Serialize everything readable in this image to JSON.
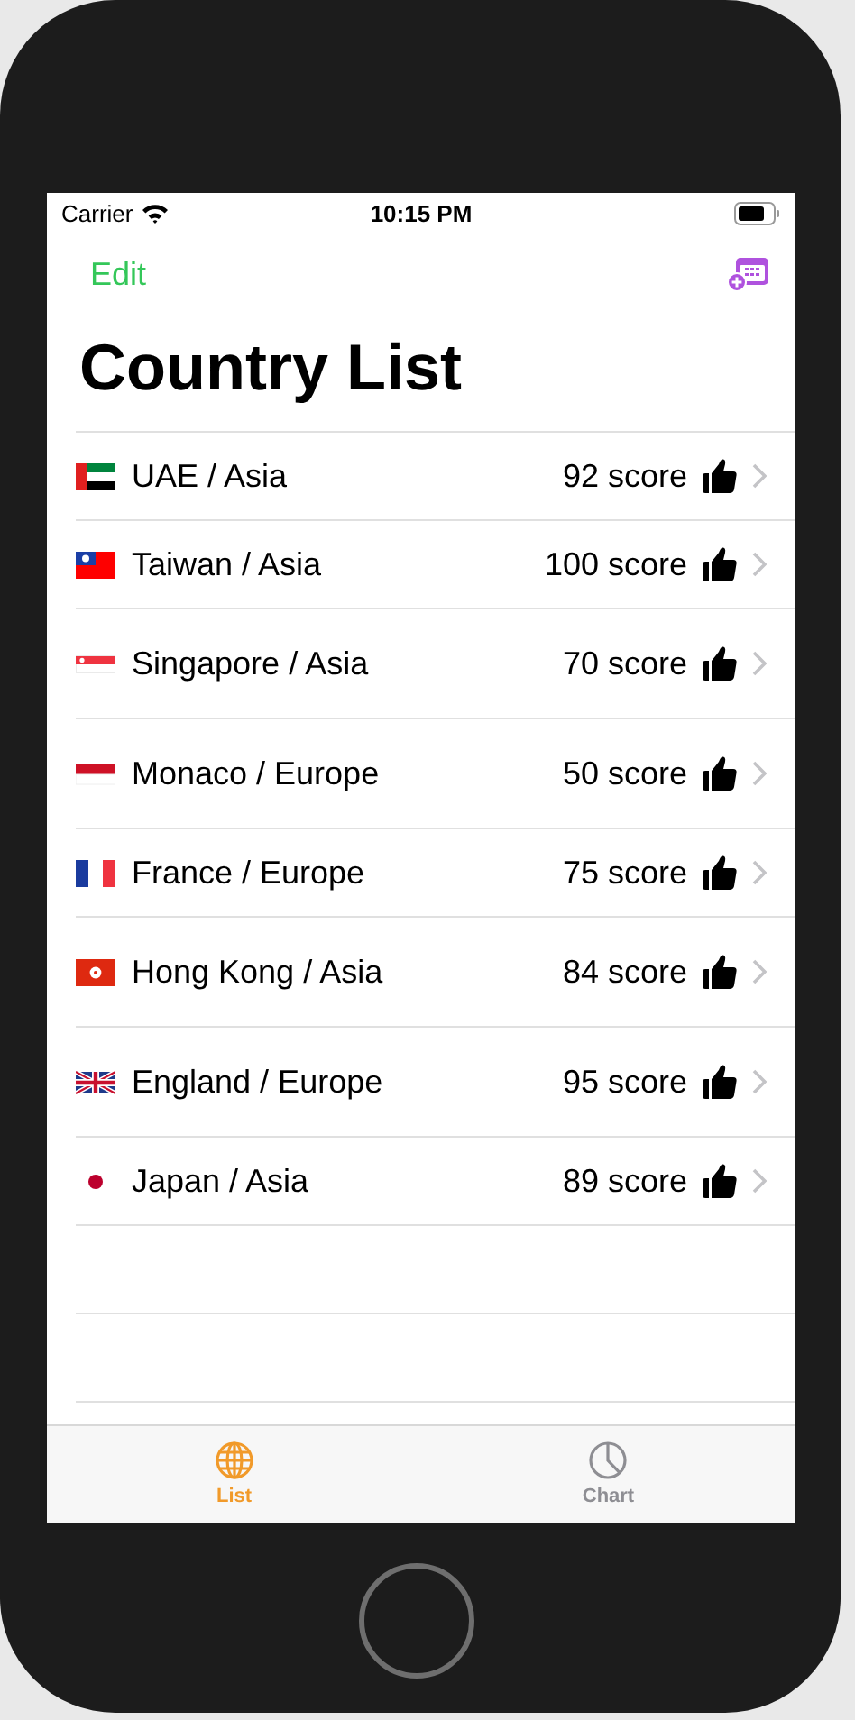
{
  "status_bar": {
    "carrier": "Carrier",
    "time": "10:15 PM"
  },
  "nav": {
    "edit": "Edit",
    "title": "Country List"
  },
  "rows": [
    {
      "kind": "uae",
      "label": "UAE / Asia",
      "score": "92 score"
    },
    {
      "kind": "taiwan",
      "label": "Taiwan / Asia",
      "score": "100 score"
    },
    {
      "kind": "singapore",
      "label": "Singapore / Asia",
      "score": "70 score"
    },
    {
      "kind": "monaco",
      "label": "Monaco / Europe",
      "score": "50 score"
    },
    {
      "kind": "france",
      "label": "France / Europe",
      "score": "75 score"
    },
    {
      "kind": "hongkong",
      "label": "Hong Kong / Asia",
      "score": "84 score"
    },
    {
      "kind": "uk",
      "label": "England / Europe",
      "score": "95 score"
    },
    {
      "kind": "japan",
      "label": "Japan / Asia",
      "score": "89 score"
    }
  ],
  "tabs": [
    {
      "kind": "globe",
      "label": "List",
      "selected": true
    },
    {
      "kind": "pie",
      "label": "Chart",
      "selected": false
    }
  ]
}
